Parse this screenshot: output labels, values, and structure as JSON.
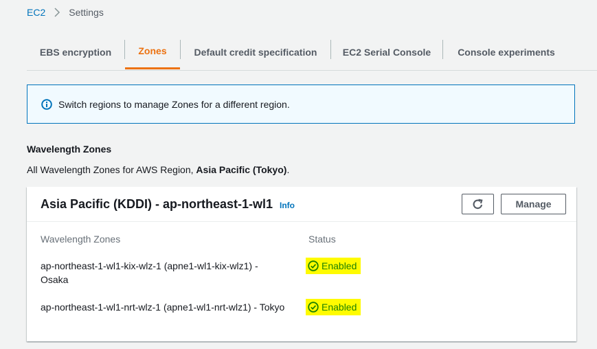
{
  "breadcrumb": {
    "root": "EC2",
    "current": "Settings"
  },
  "tabs": [
    {
      "label": "EBS encryption"
    },
    {
      "label": "Zones"
    },
    {
      "label": "Default credit specification"
    },
    {
      "label": "EC2 Serial Console"
    },
    {
      "label": "Console experiments"
    }
  ],
  "active_tab": "Zones",
  "flash": {
    "text": "Switch regions to manage Zones for a different region.",
    "icon": "info-circle-icon",
    "color": "#0073bb"
  },
  "section": {
    "title": "Wavelength Zones",
    "desc_prefix": "All Wavelength Zones for AWS Region, ",
    "desc_region": "Asia Pacific (Tokyo)",
    "desc_suffix": "."
  },
  "panel": {
    "title": "Asia Pacific (KDDI) - ap-northeast-1-wl1",
    "info": "Info",
    "manage_label": "Manage",
    "refresh_icon": "refresh-icon",
    "columns": {
      "zones": "Wavelength Zones",
      "status": "Status"
    },
    "rows": [
      {
        "name": "ap-northeast-1-wl1-kix-wlz-1 (apne1-wl1-kix-wlz1) - Osaka",
        "status": "Enabled"
      },
      {
        "name": "ap-northeast-1-wl1-nrt-wlz-1 (apne1-wl1-nrt-wlz1) - Tokyo",
        "status": "Enabled"
      }
    ]
  },
  "colors": {
    "accent": "#ec7211",
    "link": "#0073bb",
    "success": "#1d8102",
    "highlight": "#fffb00"
  }
}
